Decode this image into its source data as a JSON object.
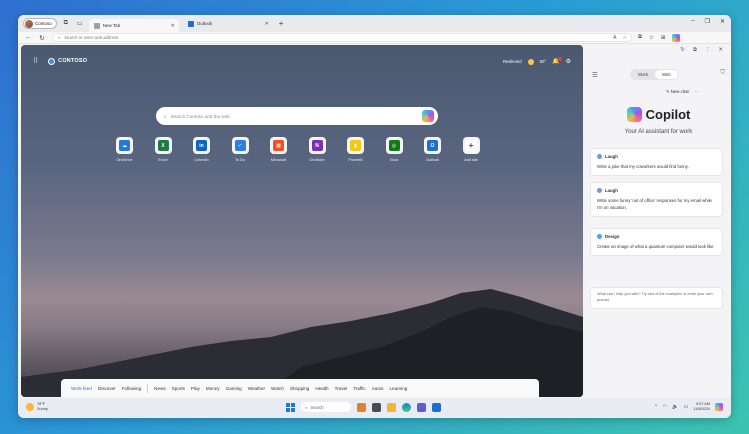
{
  "tabbar": {
    "profile_label": "Contoso",
    "tabs": [
      {
        "label": "New Tab",
        "active": true
      },
      {
        "label": "Outlook",
        "active": false
      }
    ],
    "new_tab_glyph": "+",
    "window_controls": [
      "–",
      "❐",
      "✕"
    ]
  },
  "address": {
    "placeholder": "Search or enter web address",
    "tools": [
      "A",
      "☆",
      "⧉",
      "☆",
      "⊞"
    ]
  },
  "ntp": {
    "brand": "CONTOSO",
    "location": "Redmond",
    "temperature": "50°",
    "search_placeholder": "Search Contoso and the web",
    "tiles": [
      {
        "label": "OneDrive",
        "color": "#1f7ae0",
        "glyph": "☁"
      },
      {
        "label": "Excel",
        "color": "#1f7a44",
        "glyph": "X"
      },
      {
        "label": "LinkedIn",
        "color": "#0a66c2",
        "glyph": "in"
      },
      {
        "label": "To Do",
        "color": "#2b7de9",
        "glyph": "✓"
      },
      {
        "label": "Microsoft",
        "color": "#f25022",
        "glyph": "▦"
      },
      {
        "label": "OneNote",
        "color": "#7b2fb8",
        "glyph": "N"
      },
      {
        "label": "PowerBI",
        "color": "#f2c811",
        "glyph": "▮"
      },
      {
        "label": "Xbox",
        "color": "#107c10",
        "glyph": "◎"
      },
      {
        "label": "Outlook",
        "color": "#1c6fd0",
        "glyph": "O"
      },
      {
        "label": "Add site",
        "color": "#ffffff",
        "glyph": "+"
      }
    ],
    "feed": [
      "Work feed",
      "Discover",
      "Following",
      "News",
      "Sports",
      "Play",
      "Money",
      "Gaming",
      "Weather",
      "Watch",
      "Shopping",
      "Health",
      "Travel",
      "Traffic",
      "Autos",
      "Learning"
    ]
  },
  "copilot": {
    "toggle": [
      "Work",
      "Web"
    ],
    "new_chat": "New chat",
    "more": "⋯",
    "title": "Copilot",
    "subtitle": "Your AI assistant for work",
    "cards": [
      {
        "tag": "Laugh",
        "text": "Write a joke that my coworkers would find funny."
      },
      {
        "tag": "Laugh",
        "text": "Write some funny 'out of office' responses for my email while I'm on vacation."
      },
      {
        "tag": "Design",
        "text": "Create an image of what a quantum computer would look like"
      }
    ],
    "prompt": "What can I help you with? Try one of the examples or enter your own prompt."
  },
  "taskbar": {
    "weather_temp": "78°F",
    "weather_cond": "Sunny",
    "search": "Search",
    "time": "9:07 AM",
    "date": "11/8/2024"
  }
}
